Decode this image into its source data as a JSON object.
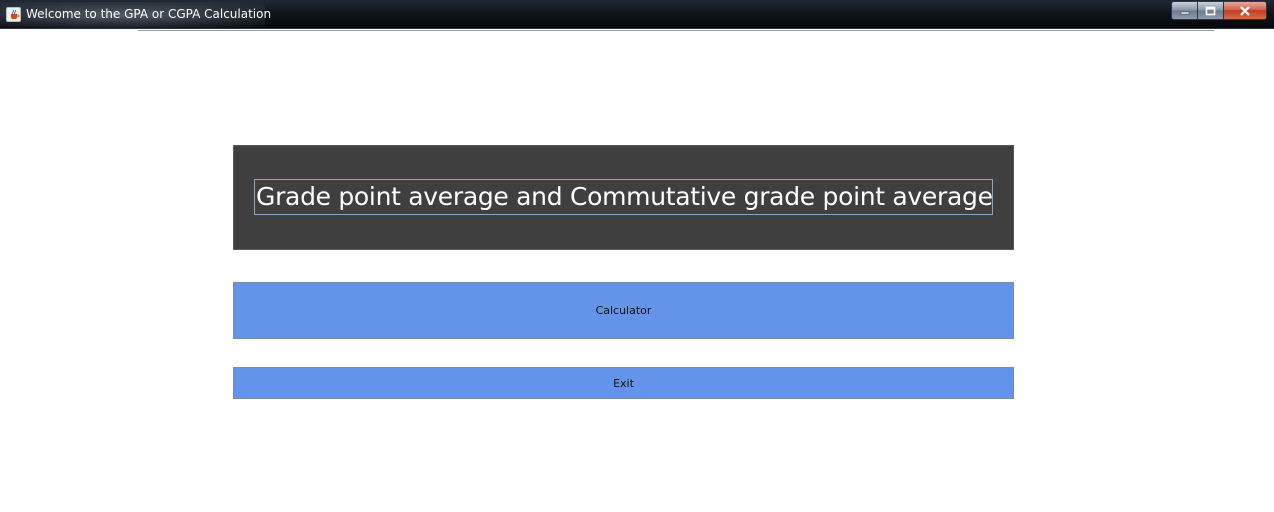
{
  "window": {
    "title": "Welcome to the GPA or CGPA Calculation",
    "icon": "java-coffee-cup-icon",
    "controls": [
      "minimize-icon",
      "maximize-icon",
      "close-icon"
    ]
  },
  "header": {
    "title": "Grade point average and Commutative grade point average",
    "background_color": "#3f3f3f",
    "text_color": "#ffffff"
  },
  "buttons": {
    "calculator_label": "Calculator",
    "exit_label": "Exit",
    "color": "#6493ea"
  }
}
